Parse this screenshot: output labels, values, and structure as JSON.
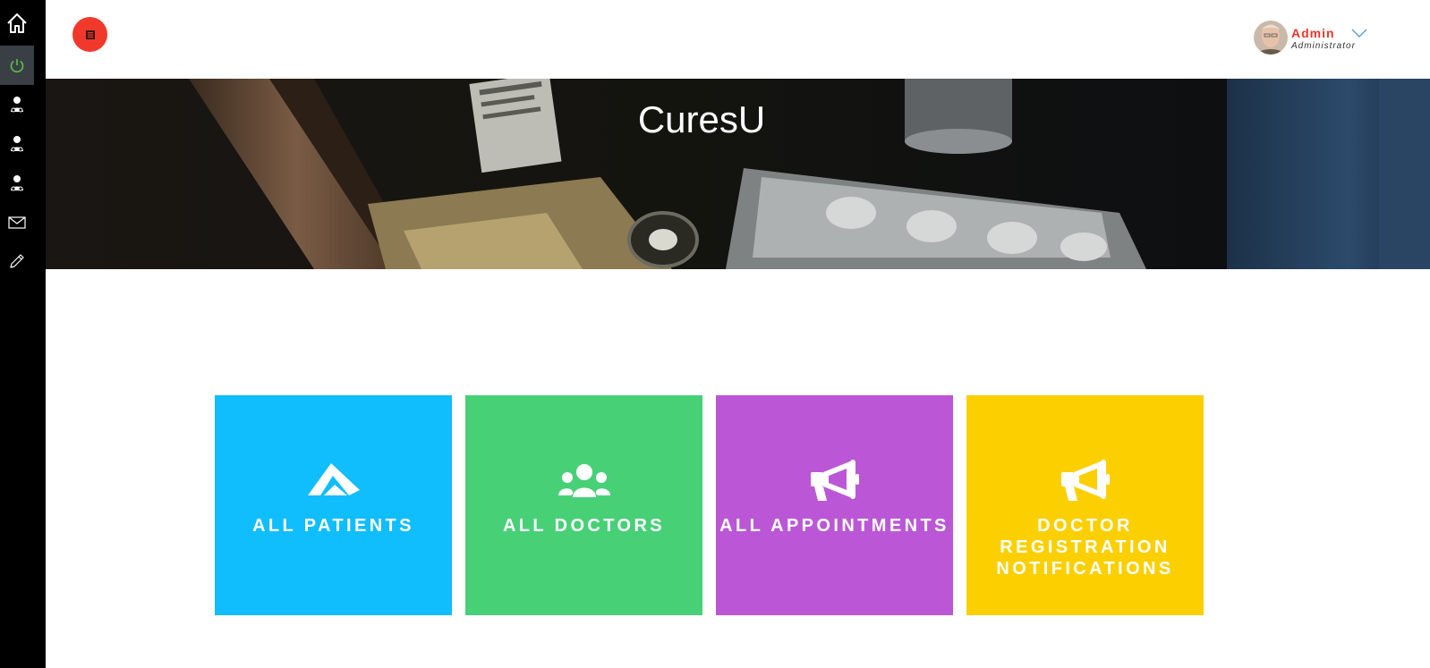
{
  "app": {
    "title": "CuresU"
  },
  "sidebar": {
    "items": [
      {
        "icon": "home-icon",
        "active": false
      },
      {
        "icon": "power-icon",
        "active": true
      },
      {
        "icon": "doctor-icon",
        "active": false
      },
      {
        "icon": "doctor-icon",
        "active": false
      },
      {
        "icon": "doctor-icon",
        "active": false
      },
      {
        "icon": "mail-icon",
        "active": false
      },
      {
        "icon": "pencil-icon",
        "active": false
      }
    ]
  },
  "header": {
    "menu_icon": "menu-icon",
    "user": {
      "name": "Admin",
      "role": "Administrator",
      "dropdown_icon": "chevron-down-icon"
    }
  },
  "hero": {
    "title": "CuresU"
  },
  "tiles": [
    {
      "label": "ALL PATIENTS",
      "icon": "patients-icon",
      "color": "#10bdfd"
    },
    {
      "label": "ALL DOCTORS",
      "icon": "users-icon",
      "color": "#48d077"
    },
    {
      "label": "ALL APPOINTMENTS",
      "icon": "megaphone-icon",
      "color": "#bb57d7"
    },
    {
      "label": "DOCTOR REGISTRATION NOTIFICATIONS",
      "icon": "megaphone-icon",
      "color": "#fbcf00"
    }
  ],
  "colors": {
    "sidebar_bg": "#000000",
    "sidebar_active": "#3a3f46",
    "accent_red": "#f0392b",
    "user_name": "#e8372b"
  }
}
